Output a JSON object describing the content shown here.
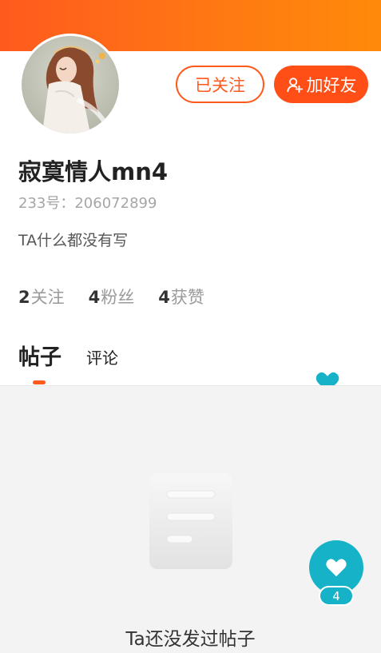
{
  "profile": {
    "username": "寂寞情人mn4",
    "uid_label": "233号：",
    "uid_value": "206072899",
    "bio": "TA什么都没有写"
  },
  "actions": {
    "follow_label": "已关注",
    "add_friend_label": "加好友"
  },
  "stats": [
    {
      "count": "2",
      "label": "关注"
    },
    {
      "count": "4",
      "label": "粉丝"
    },
    {
      "count": "4",
      "label": "获赞"
    }
  ],
  "tabs": {
    "posts": "帖子",
    "comments": "评论",
    "active": "posts"
  },
  "empty_state": {
    "message": "Ta还没发过帖子"
  },
  "like_button": {
    "count": "4"
  },
  "colors": {
    "accent": "#ff5a1e",
    "like": "#15b2c8"
  }
}
